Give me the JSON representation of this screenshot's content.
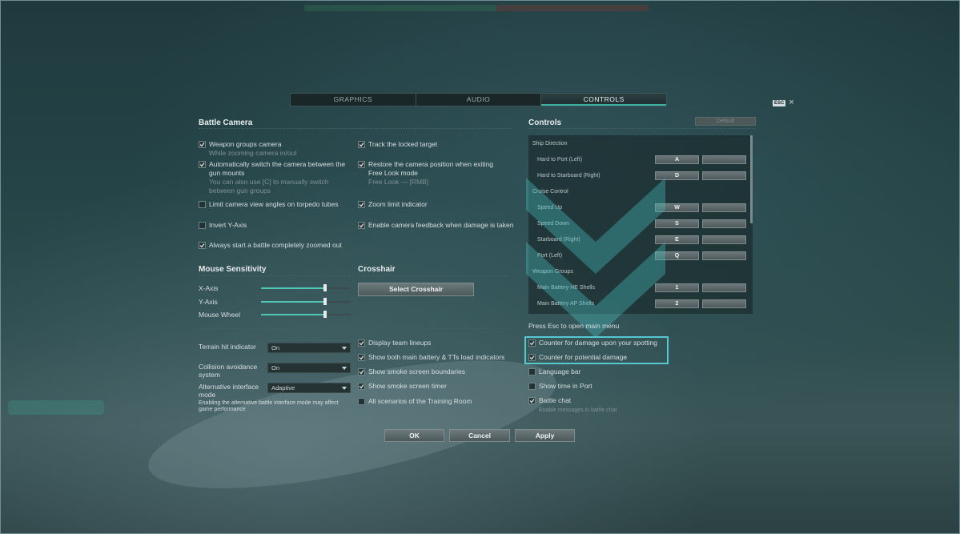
{
  "tabs": [
    {
      "label": "GRAPHICS",
      "active": false
    },
    {
      "label": "AUDIO",
      "active": false
    },
    {
      "label": "CONTROLS",
      "active": true
    }
  ],
  "esc": {
    "badge": "ESC",
    "close": "×"
  },
  "battle_camera": {
    "title": "Battle Camera",
    "left": [
      {
        "label": "Weapon groups camera",
        "sub": "While zooming camera in/out",
        "checked": true
      },
      {
        "label": "Automatically switch the camera between the gun mounts",
        "sub": "You can also use [C] to manually switch between gun groups",
        "checked": true
      },
      {
        "label": "Limit camera view angles on torpedo tubes",
        "sub": "",
        "checked": false
      },
      {
        "label": "Invert Y-Axis",
        "sub": "",
        "checked": false
      },
      {
        "label": "Always start a battle completely zoomed out",
        "sub": "",
        "checked": true
      }
    ],
    "right": [
      {
        "label": "Track the locked target",
        "sub": "",
        "checked": true
      },
      {
        "label": "Restore the camera position when exiting Free Look mode",
        "sub": "Free Look — [RMB]",
        "checked": true
      },
      {
        "label": "Zoom limit indicator",
        "sub": "",
        "checked": true
      },
      {
        "label": "Enable camera feedback when damage is taken",
        "sub": "",
        "checked": true
      }
    ]
  },
  "mouse": {
    "title": "Mouse Sensitivity",
    "sliders": [
      {
        "label": "X-Axis",
        "value": 0.71
      },
      {
        "label": "Y-Axis",
        "value": 0.71
      },
      {
        "label": "Mouse Wheel",
        "value": 0.71
      }
    ]
  },
  "crosshair": {
    "title": "Crosshair",
    "button": "Select Crosshair"
  },
  "dropdowns": [
    {
      "label": "Terrain hit indicator",
      "value": "On",
      "sub": ""
    },
    {
      "label": "Collision avoidance system",
      "value": "On",
      "sub": ""
    },
    {
      "label": "Alternative interface mode",
      "value": "Adaptive",
      "sub": "Enabling the alternative battle interface mode may affect game performance"
    }
  ],
  "middle_options": [
    {
      "label": "Display team lineups",
      "checked": true
    },
    {
      "label": "Show both main battery & TTs load indicators",
      "checked": true
    },
    {
      "label": "Show smoke screen boundaries",
      "checked": true
    },
    {
      "label": "Show smoke screen timer",
      "checked": true
    },
    {
      "label": "All scenarios of the Training Room",
      "checked": false
    }
  ],
  "controls": {
    "title": "Controls",
    "default_label": "Default",
    "rows": [
      {
        "type": "group",
        "label": "Ship Direction"
      },
      {
        "type": "bind",
        "label": "Hard to Port (Left)",
        "key": "A"
      },
      {
        "type": "bind",
        "label": "Hard to Starboard (Right)",
        "key": "D"
      },
      {
        "type": "group",
        "label": "Cruise Control"
      },
      {
        "type": "bind",
        "label": "Speed Up",
        "key": "W"
      },
      {
        "type": "bind",
        "label": "Speed Down",
        "key": "S"
      },
      {
        "type": "bind",
        "label": "Starboard (Right)",
        "key": "E"
      },
      {
        "type": "bind",
        "label": "Port (Left)",
        "key": "Q"
      },
      {
        "type": "group",
        "label": "Weapon Groups"
      },
      {
        "type": "bind",
        "label": "Main Battery HE Shells",
        "key": "1"
      },
      {
        "type": "bind",
        "label": "Main Battery AP Shells",
        "key": "2"
      }
    ],
    "hint": "Press Esc to open main menu",
    "options": [
      {
        "label": "Counter for damage upon your spotting",
        "sub": "",
        "checked": true
      },
      {
        "label": "Counter for potential damage",
        "sub": "",
        "checked": true
      },
      {
        "label": "Language bar",
        "sub": "",
        "checked": false
      },
      {
        "label": "Show time in Port",
        "sub": "",
        "checked": false
      },
      {
        "label": "Battle chat",
        "sub": "Enable messages in battle chat",
        "checked": true
      }
    ]
  },
  "footer": {
    "ok": "OK",
    "cancel": "Cancel",
    "apply": "Apply"
  },
  "colors": {
    "accent": "#4fc7b4",
    "highlight": "#56c8d0"
  }
}
